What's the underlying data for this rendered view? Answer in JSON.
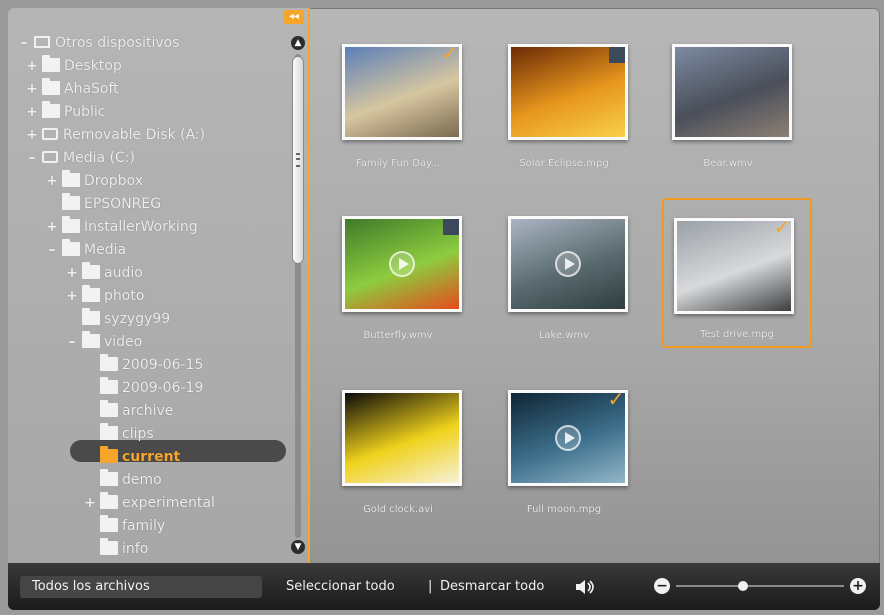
{
  "tree": {
    "items": [
      {
        "label": "Otros dispositivos",
        "expander": "–",
        "icon": "monitor",
        "level": 0
      },
      {
        "label": "Desktop",
        "expander": "+",
        "icon": "folder",
        "level": 1
      },
      {
        "label": "AhaSoft",
        "expander": "+",
        "icon": "folder",
        "level": 1
      },
      {
        "label": "Public",
        "expander": "+",
        "icon": "folder",
        "level": 1
      },
      {
        "label": "Removable Disk (A:)",
        "expander": "+",
        "icon": "drive",
        "level": 1
      },
      {
        "label": "Media (C:)",
        "expander": "–",
        "icon": "drive",
        "level": 1
      },
      {
        "label": "Dropbox",
        "expander": "+",
        "icon": "folder",
        "level": 2
      },
      {
        "label": "EPSONREG",
        "expander": "",
        "icon": "folder",
        "level": 2
      },
      {
        "label": "InstallerWorking",
        "expander": "+",
        "icon": "folder",
        "level": 2
      },
      {
        "label": "Media",
        "expander": "–",
        "icon": "folder",
        "level": 2
      },
      {
        "label": "audio",
        "expander": "+",
        "icon": "folder",
        "level": 3
      },
      {
        "label": "photo",
        "expander": "+",
        "icon": "folder",
        "level": 3
      },
      {
        "label": "syzygy99",
        "expander": "",
        "icon": "folder",
        "level": 3
      },
      {
        "label": "video",
        "expander": "–",
        "icon": "folder",
        "level": 3
      },
      {
        "label": "2009-06-15",
        "expander": "",
        "icon": "folder",
        "level": 4
      },
      {
        "label": "2009-06-19",
        "expander": "",
        "icon": "folder",
        "level": 4
      },
      {
        "label": "archive",
        "expander": "",
        "icon": "folder",
        "level": 4
      },
      {
        "label": "clips",
        "expander": "",
        "icon": "folder",
        "level": 4
      },
      {
        "label": "current",
        "expander": "",
        "icon": "folder",
        "level": 4,
        "selected": true
      },
      {
        "label": "demo",
        "expander": "",
        "icon": "folder",
        "level": 4
      },
      {
        "label": "experimental",
        "expander": "+",
        "icon": "folder",
        "level": 4
      },
      {
        "label": "family",
        "expander": "",
        "icon": "folder",
        "level": 4
      },
      {
        "label": "info",
        "expander": "",
        "icon": "folder",
        "level": 4
      }
    ]
  },
  "collapse_label": "◂◂",
  "thumbnails": [
    {
      "caption": "Family Fun Day...",
      "checked": true,
      "flag": false,
      "play": false,
      "colors": [
        "#5c7fb8",
        "#d6c6a0",
        "#7a6a50"
      ]
    },
    {
      "caption": "Solar Eclipse.mpg",
      "checked": false,
      "flag": true,
      "play": false,
      "colors": [
        "#6b2a05",
        "#e7961d",
        "#f8d04c"
      ]
    },
    {
      "caption": "Bear.wmv",
      "checked": false,
      "flag": false,
      "play": false,
      "colors": [
        "#7d8aa2",
        "#4a4f5a",
        "#8c7f74"
      ]
    },
    {
      "caption": "Butterfly.wmv",
      "checked": false,
      "flag": true,
      "play": true,
      "colors": [
        "#3f7a2a",
        "#8dcc3f",
        "#e64b1c"
      ]
    },
    {
      "caption": "Lake.wmv",
      "checked": false,
      "flag": false,
      "play": true,
      "colors": [
        "#aab4c2",
        "#5a6b70",
        "#2e3d3f"
      ]
    },
    {
      "caption": "Test drive.mpg",
      "checked": true,
      "flag": false,
      "play": false,
      "selected": true,
      "colors": [
        "#9aa0a6",
        "#d7d9db",
        "#3c3e40"
      ]
    },
    {
      "caption": "Gold clock.avi",
      "checked": false,
      "flag": false,
      "play": false,
      "colors": [
        "#0a0a0a",
        "#f0d21c",
        "#f6f0d8"
      ]
    },
    {
      "caption": "Full moon.mpg",
      "checked": true,
      "flag": false,
      "play": true,
      "colors": [
        "#0f2535",
        "#3d6f8c",
        "#93b6c8"
      ]
    }
  ],
  "bottom_bar": {
    "filter_label": "Todos los archivos",
    "select_all": "Seleccionar todo",
    "separator": "|",
    "deselect_all": "Desmarcar todo",
    "zoom_out_label": "−",
    "zoom_in_label": "+",
    "zoom_level": 0.4
  },
  "colors": {
    "accent": "#f4a52a",
    "text": "#ececec"
  }
}
